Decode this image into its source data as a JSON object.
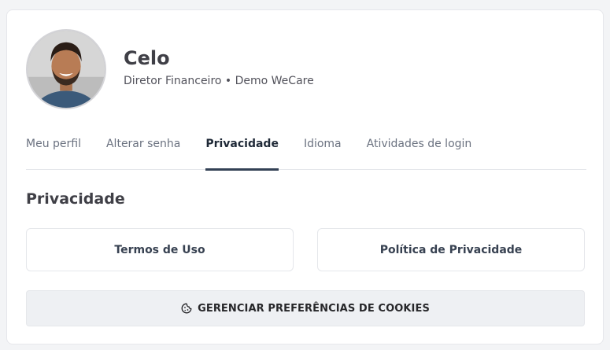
{
  "profile": {
    "name": "Celo",
    "subtitle": "Diretor Financeiro • Demo WeCare"
  },
  "tabs": [
    {
      "label": "Meu perfil",
      "active": false
    },
    {
      "label": "Alterar senha",
      "active": false
    },
    {
      "label": "Privacidade",
      "active": true
    },
    {
      "label": "Idioma",
      "active": false
    },
    {
      "label": "Atividades de login",
      "active": false
    }
  ],
  "privacy": {
    "title": "Privacidade",
    "terms_label": "Termos de Uso",
    "policy_label": "Política de Privacidade",
    "cookies_button": {
      "label": "GERENCIAR PREFERÊNCIAS DE COOKIES",
      "icon": "cookie-icon"
    }
  },
  "colors": {
    "active_tab_underline": "#334155",
    "cookie_button_bg": "#eef0f3"
  }
}
